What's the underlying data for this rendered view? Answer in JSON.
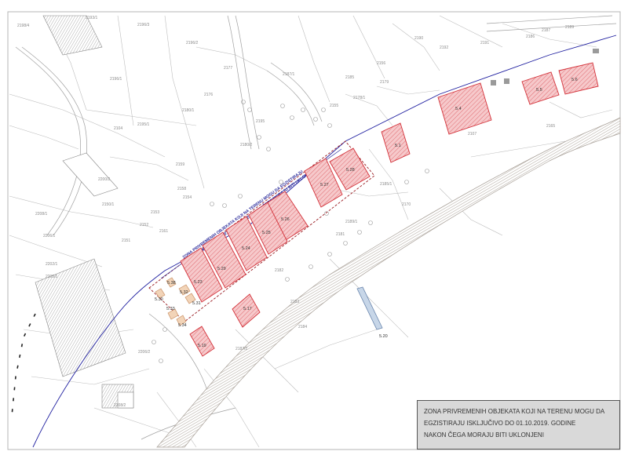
{
  "legend": {
    "line1": "ZONA PRIVREMENIH OBJEKATA KOJI NA TERENU MOGU DA",
    "line2": "EGZISTIRAJU  ISKLJUČIVO DO 01.10.2019. GODINE",
    "line3": "NAKON ČEGA MORAJU BITI UKLONJENI"
  },
  "zone_annotation": {
    "line1": "ZONA PRIVREMENIH OBJEKATA KOJI NA TERENU MOGU DA EGZISTIRAJU",
    "line2": "ISKLJUČIVO DO 01.10.2019. GODINE NAKON ČEGA MORAJU BITI UKLONJENI"
  },
  "units": [
    "5.1",
    "5.4",
    "5.5",
    "5.6",
    "5.28",
    "5.27",
    "5.26",
    "5.25",
    "5.24",
    "5.29",
    "5.23",
    "5.38",
    "5.30",
    "5.32",
    "5.31",
    "5.33",
    "5.34",
    "5.17",
    "5.19",
    "5.20"
  ],
  "parcels": [
    "2198/4",
    "2193/1",
    "2196/3",
    "2196/2",
    "2196/1",
    "2195/1",
    "2177",
    "2176",
    "2161",
    "2180/1",
    "2159",
    "2158",
    "2154",
    "2153",
    "2152",
    "2150/1",
    "2151",
    "2208/1",
    "2206/1",
    "2202/1",
    "2205/1",
    "2200/2",
    "2104",
    "2195",
    "2180/2",
    "2187/1",
    "2185",
    "2179",
    "2178/1",
    "2156",
    "2155",
    "2185/1",
    "2189/1",
    "2181",
    "2170",
    "2107",
    "2165",
    "2182",
    "2183",
    "2184",
    "2187/2",
    "2206/2",
    "2208/2",
    "2190",
    "2192",
    "2191",
    "2186",
    "2187",
    "2189"
  ],
  "colors": {
    "unit_fill": "#f6c9cb",
    "unit_hatch": "#e06a70",
    "unit_border": "#d3323a",
    "small_unit_fill": "#f2d4b8",
    "zone_outline": "#9a1c22",
    "zone_text": "#2a2a9a",
    "boundary_line": "#2020a0",
    "legend_bg": "#d9d9d9",
    "beach_strip": "#c9c2bc",
    "pier": "#8fa8c8"
  }
}
